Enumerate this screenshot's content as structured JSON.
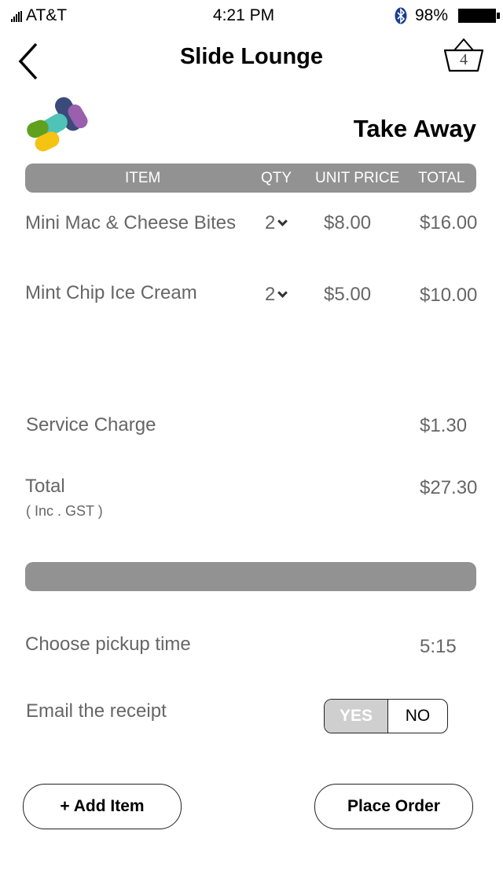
{
  "status_bar": {
    "carrier": "AT&T",
    "time": "4:21 PM",
    "battery_percent": "98%"
  },
  "header": {
    "title": "Slide Lounge",
    "basket_count": "4"
  },
  "order_type": "Take Away",
  "table": {
    "columns": [
      "ITEM",
      "QTY",
      "UNIT PRICE",
      "TOTAL"
    ],
    "rows": [
      {
        "item": "Mini Mac & Cheese Bites",
        "qty": "2",
        "unit_price": "$8.00",
        "total": "$16.00"
      },
      {
        "item": "Mint Chip Ice Cream",
        "qty": "2",
        "unit_price": "$5.00",
        "total": "$10.00"
      }
    ]
  },
  "summary": {
    "service_charge_label": "Service Charge",
    "service_charge_value": "$1.30",
    "total_label": "Total",
    "total_note": "( Inc . GST )",
    "total_value": "$27.30"
  },
  "pickup": {
    "label": "Choose pickup time",
    "value": "5:15"
  },
  "email_receipt": {
    "label": "Email the receipt",
    "yes_label": "YES",
    "no_label": "NO",
    "selected": "YES"
  },
  "actions": {
    "add_item_label": "+ Add Item",
    "place_order_label": "Place Order"
  },
  "colors": {
    "bar_gray": "#929292",
    "text_gray": "#666666",
    "toggle_selected": "#cfcfcf"
  }
}
